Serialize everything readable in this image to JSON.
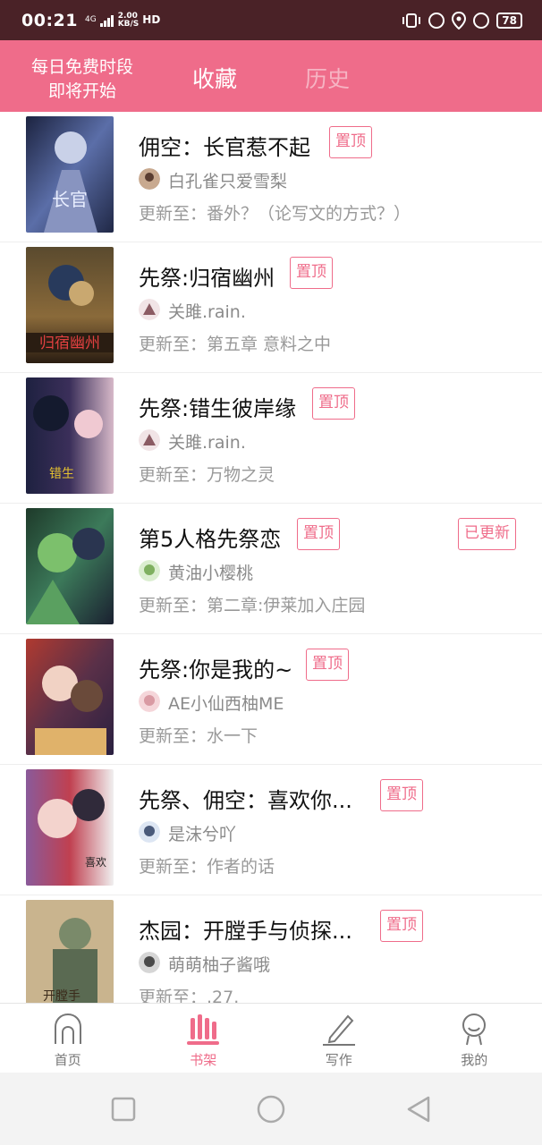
{
  "status_bar": {
    "time": "00:21",
    "signal": "4G",
    "speed_value": "2.00",
    "speed_unit": "KB/S",
    "hd": "HD",
    "battery": "78"
  },
  "header": {
    "promo_line1": "每日免费时段",
    "promo_line2": "即将开始",
    "tab_favorites": "收藏",
    "tab_history": "历史"
  },
  "labels": {
    "pin": "置顶",
    "updated": "已更新",
    "update_prefix": "更新至："
  },
  "books": [
    {
      "title": "佣空：长官惹不起",
      "author": "白孔雀只爱雪梨",
      "chapter": "番外？（论写文的方式？）",
      "updated": false
    },
    {
      "title": "先祭:归宿幽州",
      "author": "关雎.rain.",
      "chapter": "第五章 意料之中",
      "updated": false
    },
    {
      "title": "先祭:错生彼岸缘",
      "author": "关雎.rain.",
      "chapter": "万物之灵",
      "updated": false
    },
    {
      "title": "第5人格先祭恋",
      "author": "黄油小樱桃",
      "chapter": "第二章:伊莱加入庄园",
      "updated": true
    },
    {
      "title": "先祭:你是我的~",
      "author": "AE小仙西柚ME",
      "chapter": "水一下",
      "updated": false
    },
    {
      "title": "先祭、佣空：喜欢你...",
      "author": "是沫兮吖",
      "chapter": "作者的话",
      "updated": false
    },
    {
      "title": "杰园：开膛手与侦探...",
      "author": "萌萌柚子酱哦",
      "chapter": ".27.",
      "updated": false
    }
  ],
  "bottom_nav": [
    {
      "label": "首页",
      "icon": "home-icon",
      "active": false
    },
    {
      "label": "书架",
      "icon": "bookshelf-icon",
      "active": true
    },
    {
      "label": "写作",
      "icon": "pen-icon",
      "active": false
    },
    {
      "label": "我的",
      "icon": "profile-icon",
      "active": false
    }
  ],
  "colors": {
    "accent": "#ef6c8a",
    "status_bar": "#4a2227"
  }
}
